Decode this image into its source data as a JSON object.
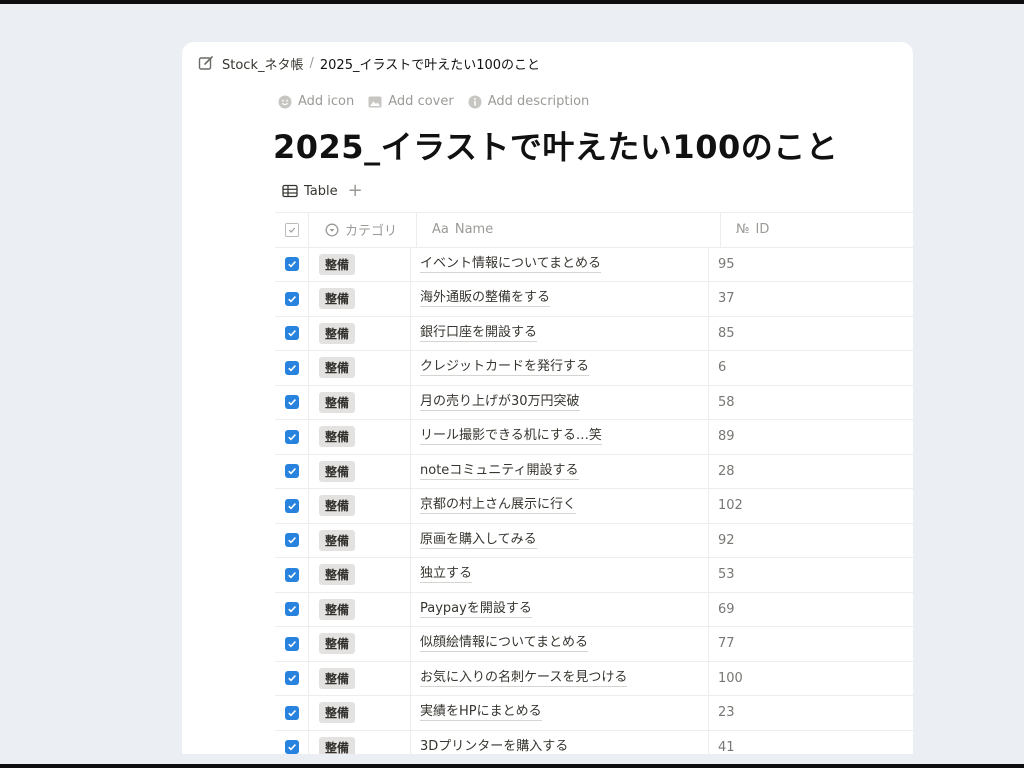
{
  "breadcrumb": {
    "parent": "Stock_ネタ帳",
    "separator": "/",
    "current": "2025_イラストで叶えたい100のこと"
  },
  "page_actions": {
    "add_icon": "Add icon",
    "add_cover": "Add cover",
    "add_description": "Add description"
  },
  "page_title": "2025_イラストで叶えたい100のこと",
  "view": {
    "tab_label": "Table",
    "add_label": "+"
  },
  "table": {
    "columns": {
      "category": "カテゴリ",
      "name_prefix": "Aa",
      "name": "Name",
      "id_prefix": "№",
      "id": "ID"
    },
    "rows": [
      {
        "done": true,
        "category": "整備",
        "name": "イベント情報についてまとめる",
        "id": "95"
      },
      {
        "done": true,
        "category": "整備",
        "name": "海外通販の整備をする",
        "id": "37"
      },
      {
        "done": true,
        "category": "整備",
        "name": "銀行口座を開設する",
        "id": "85"
      },
      {
        "done": true,
        "category": "整備",
        "name": "クレジットカードを発行する",
        "id": "6"
      },
      {
        "done": true,
        "category": "整備",
        "name": "月の売り上げが30万円突破",
        "id": "58"
      },
      {
        "done": true,
        "category": "整備",
        "name": "リール撮影できる机にする…笑",
        "id": "89"
      },
      {
        "done": true,
        "category": "整備",
        "name": "noteコミュニティ開設する",
        "id": "28"
      },
      {
        "done": true,
        "category": "整備",
        "name": "京都の村上さん展示に行く",
        "id": "102"
      },
      {
        "done": true,
        "category": "整備",
        "name": "原画を購入してみる",
        "id": "92"
      },
      {
        "done": true,
        "category": "整備",
        "name": "独立する",
        "id": "53"
      },
      {
        "done": true,
        "category": "整備",
        "name": "Paypayを開設する",
        "id": "69"
      },
      {
        "done": true,
        "category": "整備",
        "name": "似顔絵情報についてまとめる",
        "id": "77"
      },
      {
        "done": true,
        "category": "整備",
        "name": "お気に入りの名刺ケースを見つける",
        "id": "100"
      },
      {
        "done": true,
        "category": "整備",
        "name": "実績をHPにまとめる",
        "id": "23"
      },
      {
        "done": true,
        "category": "整備",
        "name": "3Dプリンターを購入する",
        "id": "41"
      }
    ]
  },
  "colors": {
    "checkbox": "#2783de",
    "tag_bg": "#e3e2e0",
    "background": "#ebeef3"
  }
}
